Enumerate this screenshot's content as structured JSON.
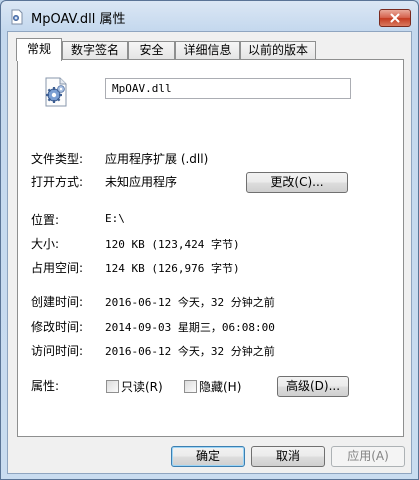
{
  "window": {
    "title": "MpOAV.dll 属性"
  },
  "tabs": [
    {
      "label": "常规",
      "active": true
    },
    {
      "label": "数字签名",
      "active": false
    },
    {
      "label": "安全",
      "active": false
    },
    {
      "label": "详细信息",
      "active": false
    },
    {
      "label": "以前的版本",
      "active": false
    }
  ],
  "general": {
    "file_name": "MpOAV.dll",
    "file_type_label": "文件类型:",
    "file_type_value": "应用程序扩展 (.dll)",
    "open_with_label": "打开方式:",
    "open_with_value": "未知应用程序",
    "change_button": "更改(C)...",
    "location_label": "位置:",
    "location_value": "E:\\",
    "size_label": "大小:",
    "size_value": "120 KB (123,424 字节)",
    "size_on_disk_label": "占用空间:",
    "size_on_disk_value": "124 KB (126,976 字节)",
    "created_label": "创建时间:",
    "created_value": "2016-06-12 今天，32 分钟之前",
    "modified_label": "修改时间:",
    "modified_value": "2014-09-03 星期三，06:08:00",
    "accessed_label": "访问时间:",
    "accessed_value": "2016-06-12 今天，32 分钟之前",
    "attributes_label": "属性:",
    "readonly_label": "只读(R)",
    "readonly_checked": false,
    "hidden_label": "隐藏(H)",
    "hidden_checked": false,
    "advanced_button": "高级(D)..."
  },
  "footer": {
    "ok_button": "确定",
    "cancel_button": "取消",
    "apply_button": "应用(A)"
  },
  "icons": {
    "title": "dll-file-icon",
    "file": "dll-gear-file-icon",
    "close": "close-icon"
  }
}
